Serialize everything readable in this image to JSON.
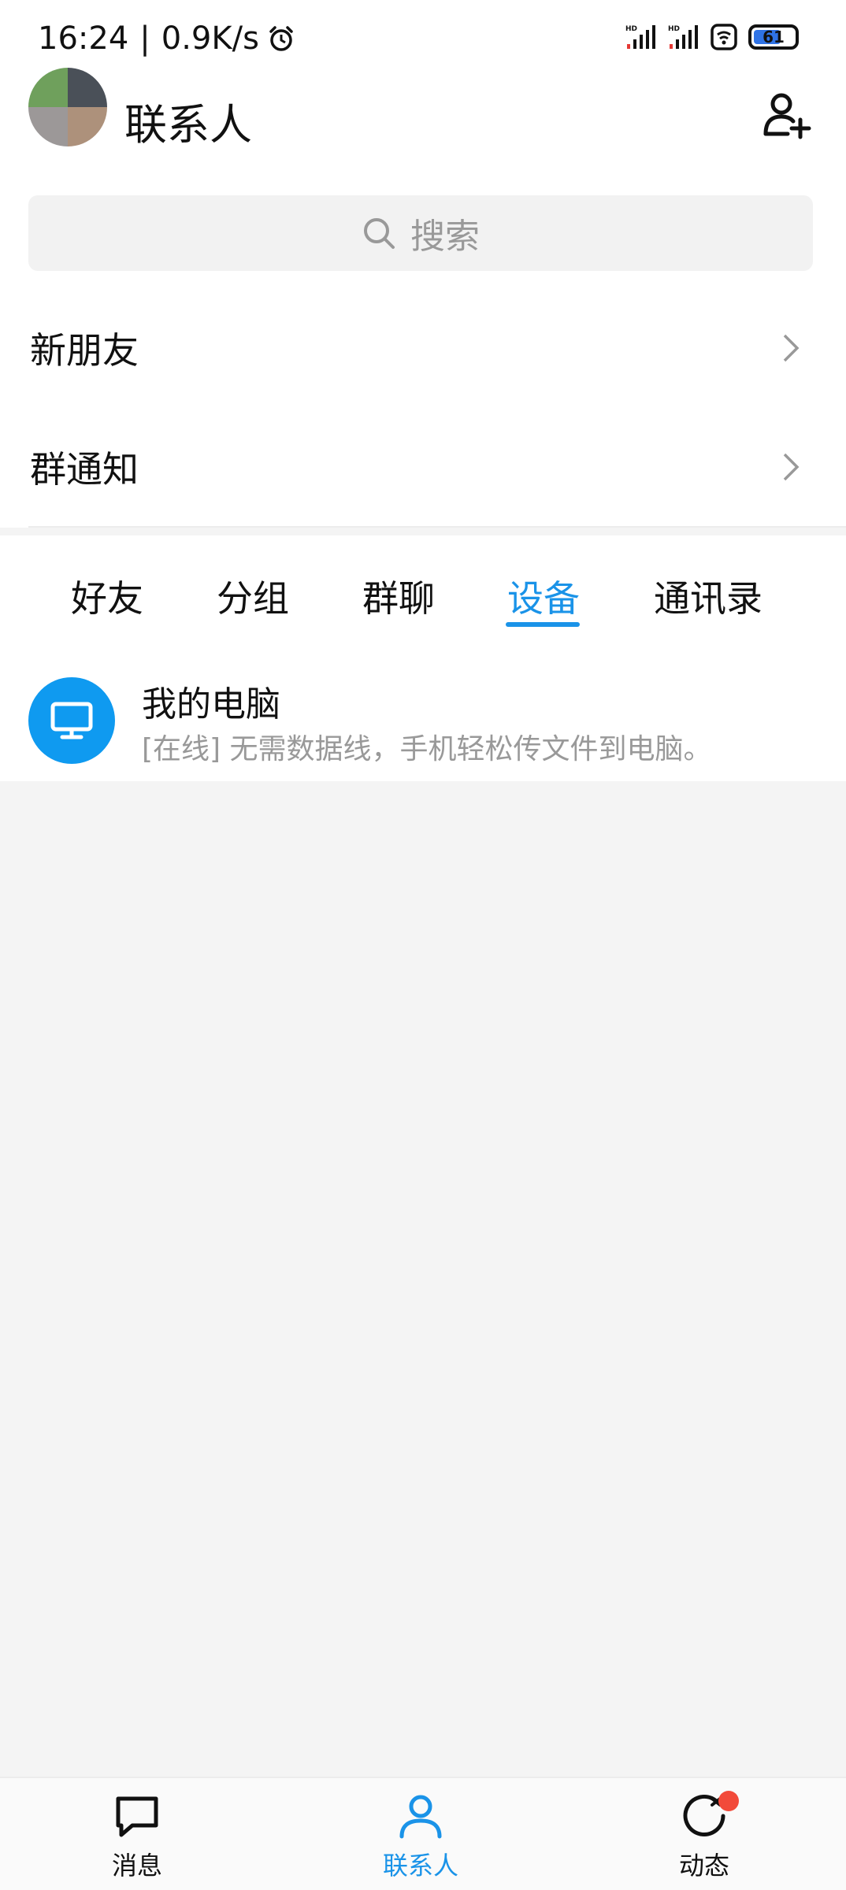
{
  "status_bar": {
    "time": "16:24",
    "separator": "|",
    "speed": "0.9K/s",
    "battery": "61"
  },
  "header": {
    "title": "联系人"
  },
  "search": {
    "label": "搜索"
  },
  "rows": [
    {
      "label": "新朋友"
    },
    {
      "label": "群通知"
    }
  ],
  "tabs": [
    {
      "label": "好友"
    },
    {
      "label": "分组"
    },
    {
      "label": "群聊"
    },
    {
      "label": "设备"
    },
    {
      "label": "通讯录"
    }
  ],
  "active_tab": "设备",
  "device": {
    "title": "我的电脑",
    "description": "[在线] 无需数据线，手机轻松传文件到电脑。"
  },
  "bottom_nav": [
    {
      "label": "消息",
      "icon": "message-icon"
    },
    {
      "label": "联系人",
      "icon": "contacts-icon"
    },
    {
      "label": "动态",
      "icon": "moments-icon"
    }
  ],
  "colors": {
    "accent": "#1a93e8",
    "device_icon_bg": "#0f9af0",
    "badge": "#f24a3a"
  }
}
